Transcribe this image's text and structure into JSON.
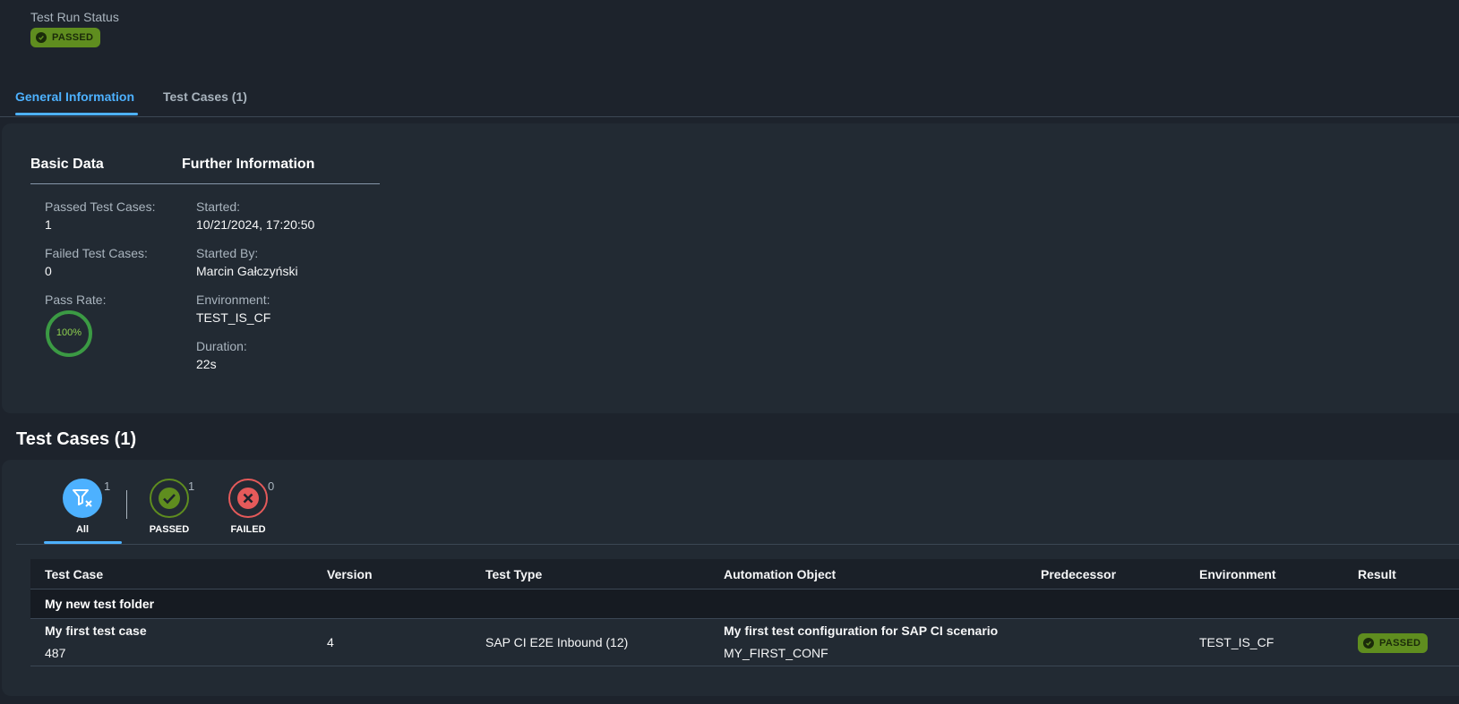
{
  "header": {
    "status_label": "Test Run Status",
    "status_badge": "PASSED"
  },
  "tabs": [
    {
      "label": "General Information",
      "active": true
    },
    {
      "label": "Test Cases (1)",
      "active": false
    }
  ],
  "general": {
    "basic_title": "Basic Data",
    "further_title": "Further Information",
    "passed_label": "Passed Test Cases:",
    "passed_value": "1",
    "failed_label": "Failed Test Cases:",
    "failed_value": "0",
    "pass_rate_label": "Pass Rate:",
    "pass_rate_value": "100%",
    "pass_rate_fraction": 1.0,
    "started_label": "Started:",
    "started_value": "10/21/2024, 17:20:50",
    "started_by_label": "Started By:",
    "started_by_value": "Marcin Gałczyński",
    "environment_label": "Environment:",
    "environment_value": "TEST_IS_CF",
    "duration_label": "Duration:",
    "duration_value": "22s"
  },
  "test_cases": {
    "title": "Test Cases (1)",
    "filters": [
      {
        "label": "All",
        "count": "1",
        "icon": "filter-clear-icon"
      },
      {
        "label": "PASSED",
        "count": "1",
        "icon": "check-circle-icon"
      },
      {
        "label": "FAILED",
        "count": "0",
        "icon": "error-circle-icon"
      }
    ],
    "columns": [
      "Test Case",
      "Version",
      "Test Type",
      "Automation Object",
      "Predecessor",
      "Environment",
      "Result"
    ],
    "group": "My new test folder",
    "rows": [
      {
        "test_case": "My first test case",
        "test_case_id": "487",
        "version": "4",
        "test_type": "SAP CI E2E Inbound (12)",
        "automation_object": "My first test configuration for SAP CI scenario",
        "automation_object_id": "MY_FIRST_CONF",
        "predecessor": "",
        "environment": "TEST_IS_CF",
        "result": "PASSED"
      }
    ]
  },
  "colors": {
    "accent": "#4db1ff",
    "success": "#5f8d1f",
    "error": "#e55a5a",
    "background": "#1d232c"
  }
}
